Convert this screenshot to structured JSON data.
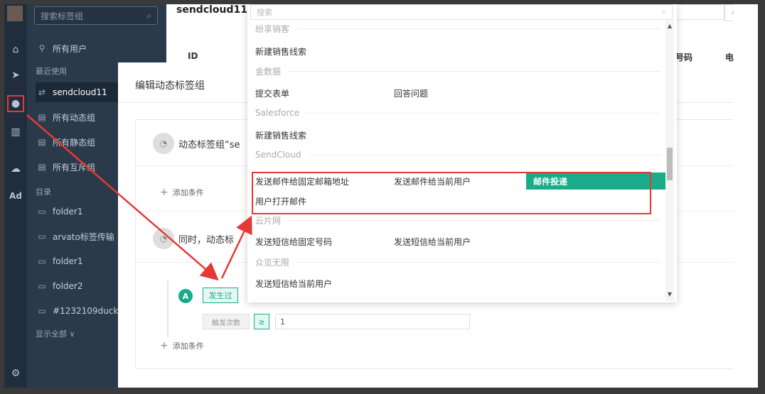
{
  "sidebar": {
    "search_placeholder": "搜索标签组",
    "all_users": "所有用户",
    "recent_label": "最近使用",
    "items": [
      {
        "label": "sendcloud11"
      },
      {
        "label": "所有动态组"
      },
      {
        "label": "所有静态组"
      },
      {
        "label": "所有互斥组"
      }
    ],
    "directory_label": "目录",
    "folders": [
      {
        "label": "folder1"
      },
      {
        "label": "arvato标签传输"
      },
      {
        "label": "folder1"
      },
      {
        "label": "folder2"
      },
      {
        "label": "#1232109duck"
      }
    ],
    "show_all": "显示全部 ∨"
  },
  "rail": {
    "ad_label": "Ad"
  },
  "content": {
    "title": "sendcloud11",
    "col_id": "ID",
    "col_phone": "号码",
    "col_e": "电"
  },
  "modal": {
    "title": "编辑动态标签组",
    "card_head": "动态标签组“se",
    "add_condition": "添加条件",
    "second_head": "同时，动态标",
    "a_badge": "A",
    "happened": "发生过",
    "trigger_count": "触发次数",
    "gte": "≥",
    "count_value": "1",
    "add_condition_2": "添加条件"
  },
  "dropdown": {
    "search_placeholder": "搜索",
    "groups": [
      {
        "name": "纷享销客"
      },
      {
        "name": "金数据"
      },
      {
        "name": "Salesforce"
      },
      {
        "name": "SendCloud"
      },
      {
        "name": "云片网"
      },
      {
        "name": "众览无限"
      }
    ],
    "options": {
      "fx_new_lead": "新建销售线索",
      "jsj_submit_form": "提交表单",
      "jsj_answer": "回答问题",
      "sf_new_lead": "新建销售线索",
      "sc_send_fixed": "发送邮件给固定邮箱地址",
      "sc_send_current": "发送邮件给当前用户",
      "sc_delivery": "邮件投递",
      "sc_open": "用户打开邮件",
      "yp_sms_fixed": "发送短信给固定号码",
      "yp_sms_current": "发送短信给当前用户",
      "zl_sms_current": "发送短信给当前用户"
    }
  },
  "colors": {
    "accent": "#1aab8a",
    "sidebar_bg": "#2a3a4b",
    "rail_bg": "#1f2d3d",
    "annotation_red": "#e53935"
  }
}
